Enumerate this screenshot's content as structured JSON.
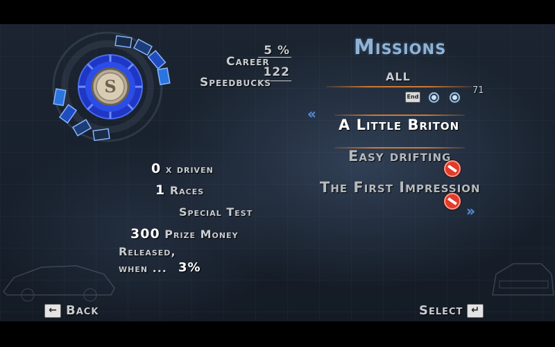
{
  "career": {
    "value": "5 %",
    "label": "Career"
  },
  "speedbucks": {
    "value": "122",
    "label": "Speedbucks"
  },
  "missions": {
    "title": "Missions",
    "filter": "ALL",
    "count": "71",
    "end_key": "End",
    "items": [
      {
        "name": "A Little Briton",
        "selected": true,
        "locked": false
      },
      {
        "name": "Easy drifting",
        "selected": false,
        "locked": true
      },
      {
        "name": "The First Impression",
        "selected": false,
        "locked": true
      }
    ]
  },
  "details": {
    "driven_value": "0",
    "driven_label": "x driven",
    "races_value": "1",
    "races_label": "Races",
    "type": "Special Test",
    "prize_value": "300",
    "prize_label": "Prize Money",
    "released_line1": "Released,",
    "released_line2": "when ...",
    "released_value": "3%"
  },
  "footer": {
    "back_label": "Back",
    "select_label": "Select"
  },
  "colors": {
    "accent_orange": "#d07a32",
    "title_blue": "#8fb3d6",
    "locked_red": "#e43a2a",
    "dial_blue": "#2e4fd8"
  },
  "icons": [
    "speedbucks-coin-icon",
    "enter-key-icon",
    "backspace-key-icon",
    "no-entry-icon",
    "chevron-left-icon",
    "chevron-right-icon"
  ]
}
